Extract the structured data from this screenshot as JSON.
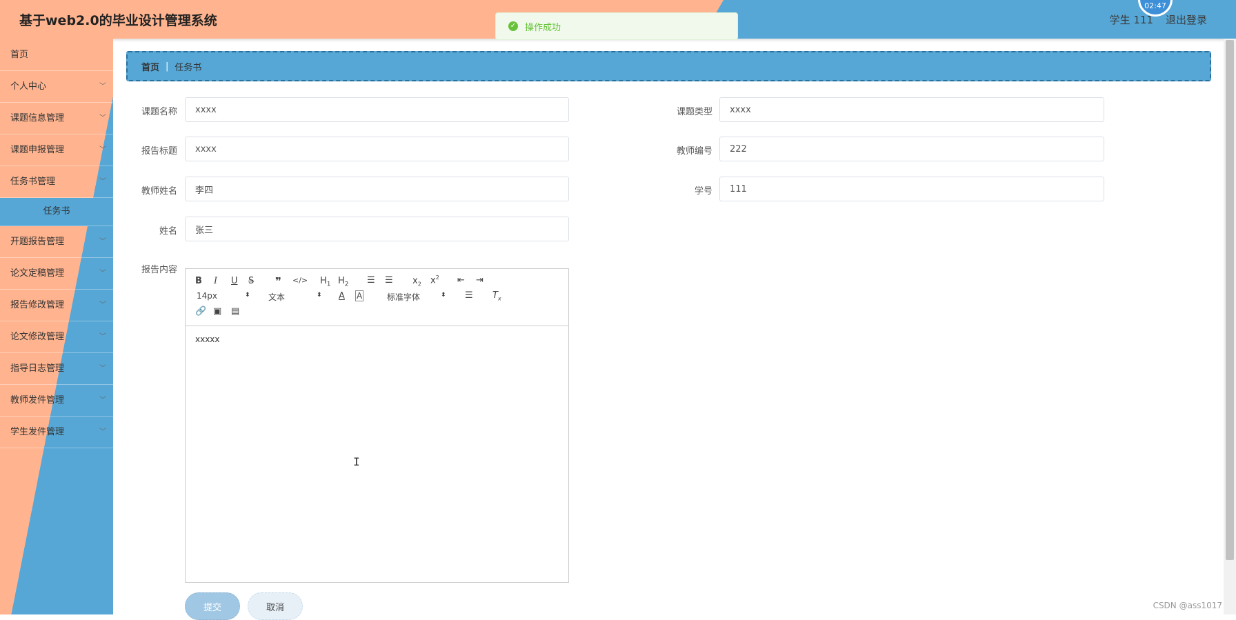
{
  "header": {
    "title": "基于web2.0的毕业设计管理系统",
    "user": "学生 111",
    "logout": "退出登录",
    "clock": "02:47"
  },
  "toast": {
    "message": "操作成功",
    "icon": "check-circle-icon",
    "color": "#67c23a"
  },
  "sidebar": {
    "items": [
      {
        "label": "首页"
      },
      {
        "label": "个人中心"
      },
      {
        "label": "课题信息管理"
      },
      {
        "label": "课题申报管理"
      },
      {
        "label": "任务书管理"
      },
      {
        "label": "任务书"
      },
      {
        "label": "开题报告管理"
      },
      {
        "label": "论文定稿管理"
      },
      {
        "label": "报告修改管理"
      },
      {
        "label": "论文修改管理"
      },
      {
        "label": "指导日志管理"
      },
      {
        "label": "教师发件管理"
      },
      {
        "label": "学生发件管理"
      }
    ]
  },
  "breadcrumb": {
    "home": "首页",
    "separator": "|",
    "current": "任务书"
  },
  "form": {
    "topic_name": {
      "label": "课题名称",
      "value": "xxxx"
    },
    "topic_type": {
      "label": "课题类型",
      "value": "xxxx"
    },
    "report_title": {
      "label": "报告标题",
      "value": "xxxx"
    },
    "teacher_no": {
      "label": "教师编号",
      "value": "222"
    },
    "teacher_name": {
      "label": "教师姓名",
      "value": "李四"
    },
    "student_no": {
      "label": "学号",
      "value": "111"
    },
    "name": {
      "label": "姓名",
      "value": "张三"
    },
    "report_content": {
      "label": "报告内容",
      "value": "xxxxx"
    }
  },
  "editor": {
    "font_size": "14px",
    "block_type": "文本",
    "font_family": "标准字体"
  },
  "buttons": {
    "submit": "提交",
    "cancel": "取消"
  },
  "watermark": "CSDN @ass1017",
  "colors": {
    "salmon": "#ffb48f",
    "blue": "#56a7d6"
  }
}
